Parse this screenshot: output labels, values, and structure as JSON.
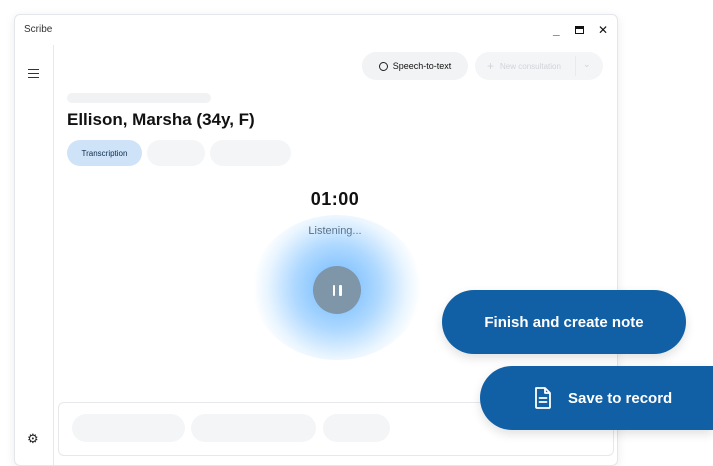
{
  "window": {
    "title": "Scribe"
  },
  "header": {
    "speech_to_text_label": "Speech-to-text",
    "new_consultation_label": "New consultation"
  },
  "patient": {
    "name": "Ellison, Marsha (34y, F)"
  },
  "tabs": [
    {
      "label": "Transcription",
      "active": true
    }
  ],
  "recording": {
    "timer": "01:00",
    "status": "Listening..."
  },
  "actions": {
    "finish_label": "Finish and create note",
    "save_label": "Save to record"
  },
  "icons": {
    "menu": "hamburger-icon",
    "settings": "gear-icon",
    "speech": "chat-bubble-icon",
    "add": "plus-icon",
    "dropdown": "chevron-down-icon",
    "pause": "pause-icon",
    "document": "document-icon"
  },
  "colors": {
    "primary": "#1160a6",
    "tab_active": "#cfe3f8",
    "pause_button": "#7f95a8",
    "glow": "#64b4ff"
  }
}
